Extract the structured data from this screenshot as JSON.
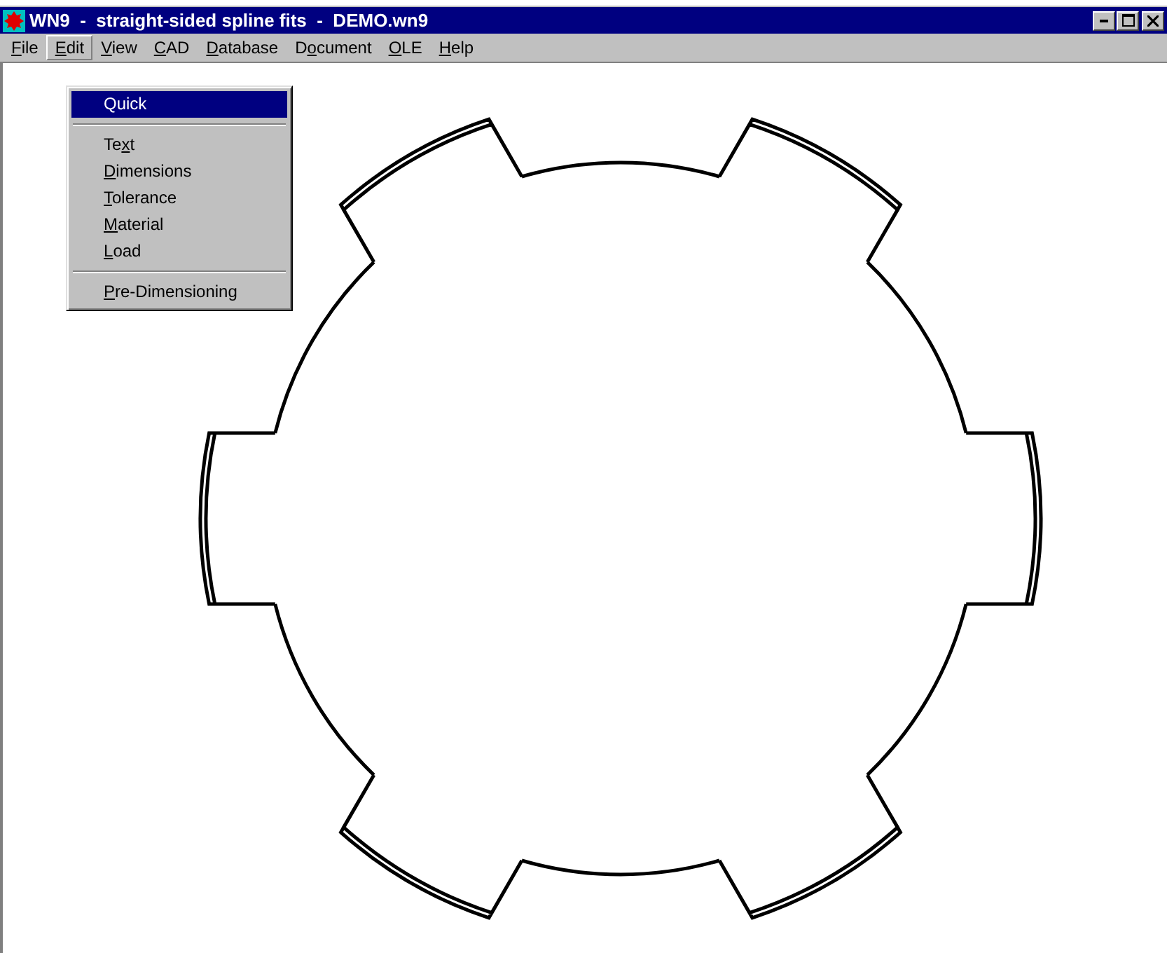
{
  "window": {
    "title": "WN9  -  straight-sided spline fits  -  DEMO.wn9"
  },
  "menu_bar": [
    {
      "access_key": "F",
      "label_end": "ile",
      "selected": false
    },
    {
      "access_key": "E",
      "label_end": "dit",
      "selected": true
    },
    {
      "access_key": "V",
      "label_end": "iew",
      "selected": false
    },
    {
      "access_key": "C",
      "label_end": "AD",
      "selected": false
    },
    {
      "access_key": "D",
      "label_end": "atabase",
      "selected": false
    },
    {
      "label_start": "D",
      "access_key": "o",
      "label_end": "cument",
      "selected": false
    },
    {
      "access_key": "O",
      "label_end": "LE",
      "selected": false
    },
    {
      "access_key": "H",
      "label_end": "elp",
      "selected": false
    }
  ],
  "edit_menu": [
    {
      "kind": "item",
      "label_start": "Quick",
      "selected": true
    },
    {
      "kind": "separator"
    },
    {
      "kind": "item",
      "label_start": "Te",
      "access_key": "x",
      "label_end": "t",
      "selected": false
    },
    {
      "kind": "item",
      "access_key": "D",
      "label_end": "imensions",
      "selected": false
    },
    {
      "kind": "item",
      "access_key": "T",
      "label_end": "olerance",
      "selected": false
    },
    {
      "kind": "item",
      "access_key": "M",
      "label_end": "aterial",
      "selected": false
    },
    {
      "kind": "item",
      "access_key": "L",
      "label_end": "oad",
      "selected": false
    },
    {
      "kind": "separator"
    },
    {
      "kind": "item",
      "access_key": "P",
      "label_end": "re-Dimensioning",
      "selected": false
    }
  ]
}
